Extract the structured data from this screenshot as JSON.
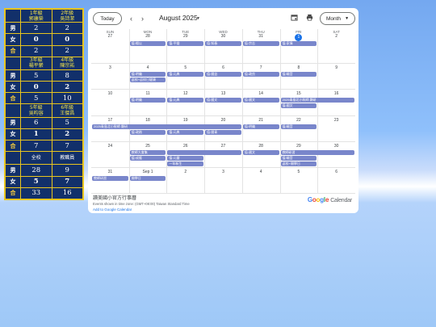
{
  "stats": {
    "groups": [
      {
        "headers": [
          "1年級\n郭康榮",
          "2年級\n吳詩潔"
        ],
        "boys": [
          "2",
          "2"
        ],
        "girls": [
          "0",
          "0"
        ],
        "total": [
          "2",
          "2"
        ]
      },
      {
        "headers": [
          "3年級\n楊平縈",
          "4年級\n陳宗祐"
        ],
        "boys": [
          "5",
          "8"
        ],
        "girls": [
          "0",
          "2"
        ],
        "total": [
          "5",
          "10"
        ]
      },
      {
        "headers": [
          "5年級\n吳昀容",
          "6年級\n王傑昌"
        ],
        "boys": [
          "6",
          "5"
        ],
        "girls": [
          "1",
          "2"
        ],
        "total": [
          "7",
          "7"
        ]
      },
      {
        "headers": [
          "全校",
          "教職員"
        ],
        "boys": [
          "28",
          "9"
        ],
        "girls": [
          "5",
          "7"
        ],
        "total": [
          "33",
          "16"
        ]
      }
    ],
    "labels": {
      "boy": "男",
      "girl": "女",
      "total": "合"
    }
  },
  "calendar": {
    "today_label": "Today",
    "month_title": "August 2025",
    "view_label": "Month",
    "weekdays": [
      "SUN",
      "MON",
      "TUE",
      "WED",
      "THU",
      "FRI",
      "SAT"
    ],
    "weeks": [
      [
        "27",
        "28",
        "29",
        "30",
        "31",
        "Aug 1",
        "2"
      ],
      [
        "3",
        "4",
        "5",
        "6",
        "7",
        "8",
        "9"
      ],
      [
        "10",
        "11",
        "12",
        "13",
        "14",
        "15",
        "16"
      ],
      [
        "17",
        "18",
        "19",
        "20",
        "21",
        "22",
        "23"
      ],
      [
        "24",
        "25",
        "26",
        "27",
        "28",
        "29",
        "30"
      ],
      [
        "31",
        "Sep 1",
        "2",
        "3",
        "4",
        "5",
        "6"
      ]
    ],
    "today_day": "1",
    "events": [
      {
        "week": 0,
        "start": 1,
        "span": 1,
        "slot": 0,
        "text": "值:楊以"
      },
      {
        "week": 0,
        "start": 2,
        "span": 1,
        "slot": 0,
        "text": "值:平聲"
      },
      {
        "week": 0,
        "start": 3,
        "span": 1,
        "slot": 0,
        "text": "值:知春"
      },
      {
        "week": 0,
        "start": 4,
        "span": 1,
        "slot": 0,
        "text": "值:宗志"
      },
      {
        "week": 0,
        "start": 5,
        "span": 1,
        "slot": 0,
        "text": "值:家偉"
      },
      {
        "week": 1,
        "start": 1,
        "span": 1,
        "slot": 0,
        "text": "值:明儀"
      },
      {
        "week": 1,
        "start": 1,
        "span": 1,
        "slot": 1,
        "text": "返校+返校日健康"
      },
      {
        "week": 1,
        "start": 2,
        "span": 1,
        "slot": 0,
        "text": "值:元典"
      },
      {
        "week": 1,
        "start": 3,
        "span": 1,
        "slot": 0,
        "text": "值:國益"
      },
      {
        "week": 1,
        "start": 4,
        "span": 1,
        "slot": 0,
        "text": "值:政良"
      },
      {
        "week": 1,
        "start": 5,
        "span": 1,
        "slot": 0,
        "text": "值:曉音"
      },
      {
        "week": 2,
        "start": 1,
        "span": 1,
        "slot": 0,
        "text": "值:明儀"
      },
      {
        "week": 2,
        "start": 2,
        "span": 1,
        "slot": 0,
        "text": "值:元典"
      },
      {
        "week": 2,
        "start": 3,
        "span": 1,
        "slot": 0,
        "text": "值:國文"
      },
      {
        "week": 2,
        "start": 4,
        "span": 1,
        "slot": 0,
        "text": "值:國文"
      },
      {
        "week": 2,
        "start": 5,
        "span": 2,
        "slot": 0,
        "text": "2025青島北小幹師 縣研"
      },
      {
        "week": 2,
        "start": 5,
        "span": 1,
        "slot": 1,
        "text": "值:國文"
      },
      {
        "week": 3,
        "start": 0,
        "span": 4,
        "slot": 0,
        "text": "2025青島北小幹師 縣研"
      },
      {
        "week": 3,
        "start": 1,
        "span": 1,
        "slot": 1,
        "text": "值:政務"
      },
      {
        "week": 3,
        "start": 2,
        "span": 1,
        "slot": 1,
        "text": "值:元典"
      },
      {
        "week": 3,
        "start": 3,
        "span": 1,
        "slot": 1,
        "text": "值:國青"
      },
      {
        "week": 3,
        "start": 4,
        "span": 1,
        "slot": 0,
        "text": "值:明儀"
      },
      {
        "week": 3,
        "start": 5,
        "span": 1,
        "slot": 0,
        "text": "值:曉音"
      },
      {
        "week": 4,
        "start": 1,
        "span": 1,
        "slot": 0,
        "text": "教師大會集"
      },
      {
        "week": 4,
        "start": 1,
        "span": 1,
        "slot": 1,
        "text": "值:成隆"
      },
      {
        "week": 4,
        "start": 2,
        "span": 1,
        "slot": 1,
        "text": "值:元豐"
      },
      {
        "week": 4,
        "start": 2,
        "span": 1,
        "slot": 2,
        "text": "一年新生"
      },
      {
        "week": 4,
        "start": 2,
        "span": 2,
        "slot": 0,
        "text": ""
      },
      {
        "week": 4,
        "start": 4,
        "span": 1,
        "slot": 0,
        "text": "值:國文"
      },
      {
        "week": 4,
        "start": 5,
        "span": 2,
        "slot": 0,
        "text": "教師研習"
      },
      {
        "week": 4,
        "start": 5,
        "span": 1,
        "slot": 1,
        "text": "值:曉音"
      },
      {
        "week": 4,
        "start": 5,
        "span": 1,
        "slot": 2,
        "text": "返校+開學日"
      },
      {
        "week": 5,
        "start": 0,
        "span": 1,
        "slot": 0,
        "text": "教師研習"
      },
      {
        "week": 5,
        "start": 1,
        "span": 1,
        "slot": 0,
        "text": "開學日"
      }
    ],
    "footer": {
      "name": "讀美國小官方行事曆",
      "timezone": "Events shown in time zone: (GMT+08:00) Taiwan Standard Time",
      "add_link": "Add to Google Calendar",
      "brand": "Calendar"
    }
  }
}
